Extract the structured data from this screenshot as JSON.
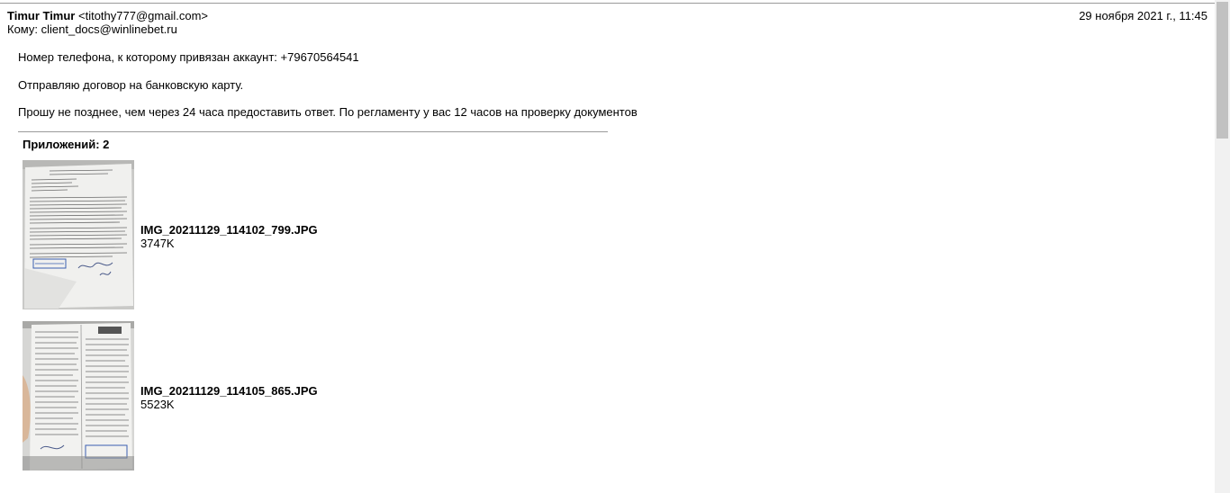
{
  "header": {
    "from_name": "Timur Timur",
    "from_email": "<titothy777@gmail.com>",
    "date": "29 ноября 2021 г., 11:45",
    "to_label": "Кому:",
    "to_address": "client_docs@winlinebet.ru"
  },
  "body": {
    "paragraphs": [
      "Номер телефона, к которому привязан аккаунт: +79670564541",
      "Отправляю договор на банковскую карту.",
      "Прошу не позднее, чем через 24 часа предоставить ответ. По регламенту у вас 12 часов на проверку документов"
    ]
  },
  "attachments": {
    "count_label": "Приложений: 2",
    "items": [
      {
        "filename": "IMG_20211129_114102_799.JPG",
        "size": "3747K"
      },
      {
        "filename": "IMG_20211129_114105_865.JPG",
        "size": "5523K"
      }
    ]
  }
}
